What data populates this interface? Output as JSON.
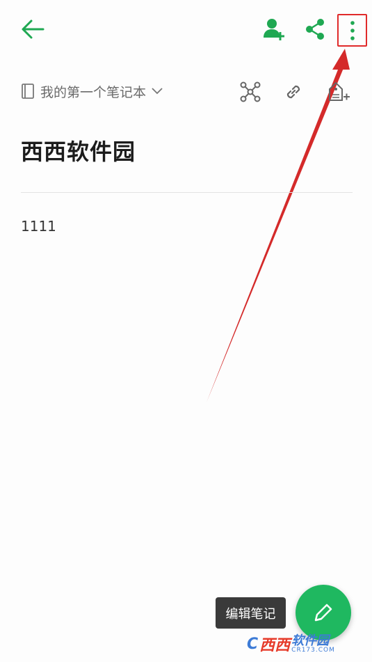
{
  "toolbar": {
    "back_icon": "arrow-left-icon",
    "share_with_person_icon": "person-add-icon",
    "share_icon": "share-icon",
    "more_icon": "more-vertical-icon"
  },
  "notebook_bar": {
    "notebook_name": "我的第一个笔记本",
    "notebook_icon": "notebook-icon",
    "dropdown_icon": "chevron-down-icon",
    "graph_icon": "graph-network-icon",
    "link_icon": "link-icon",
    "tag_icon": "tag-add-icon"
  },
  "note": {
    "title": "西西软件园",
    "body": "1111"
  },
  "fab": {
    "tooltip": "编辑笔记",
    "icon": "pencil-icon"
  },
  "watermark": {
    "logo": "C",
    "name_red": "西西",
    "name_blue": "软件园",
    "url": "CR173.COM"
  },
  "colors": {
    "accent_green": "#1fb860",
    "annotation_red": "#e02a2a",
    "icon_gray": "#6e6e6e"
  }
}
